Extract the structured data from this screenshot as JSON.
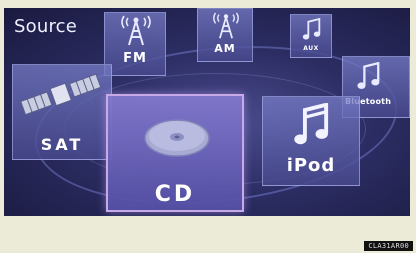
{
  "screen": {
    "title": "Source"
  },
  "sources": {
    "fm": {
      "label": "FM",
      "icon": "radio-tower-icon"
    },
    "am": {
      "label": "AM",
      "icon": "radio-tower-icon"
    },
    "aux": {
      "label": "AUX",
      "icon": "music-note-icon"
    },
    "bluetooth": {
      "label": "Bluetooth",
      "icon": "music-note-icon"
    },
    "sat": {
      "label": "SAT",
      "icon": "satellite-icon"
    },
    "cd": {
      "label": "CD",
      "icon": "disc-icon",
      "selected": true
    },
    "ipod": {
      "label": "iPod",
      "icon": "music-note-icon"
    }
  },
  "footer": {
    "code": "CLA31AR00"
  },
  "colors": {
    "background": "#ecebd8",
    "screen_dark": "#1a1a40",
    "screen_mid": "#4b4d8f",
    "tile_border": "#b4b9f0",
    "selected_border": "#c6a9e6",
    "label": "#ffffff"
  }
}
